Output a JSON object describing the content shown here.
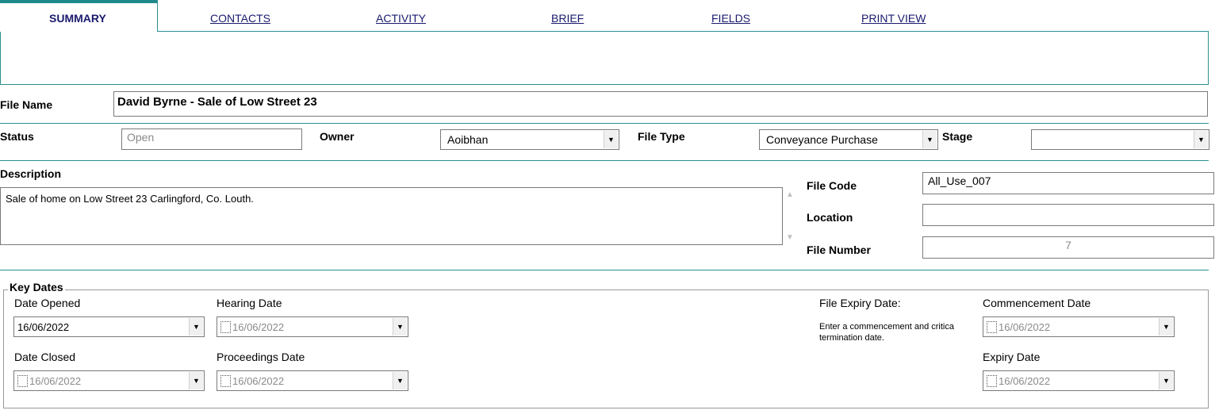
{
  "tabs": {
    "summary": "SUMMARY",
    "contacts": "CONTACTS",
    "activity": "ACTIVITY",
    "brief": "BRIEF",
    "fields": "FIELDS",
    "print_view": "PRINT VIEW"
  },
  "file_name": {
    "label": "File Name",
    "value": "David Byrne - Sale of Low Street 23"
  },
  "status": {
    "label": "Status",
    "value": "Open"
  },
  "owner": {
    "label": "Owner",
    "value": "Aoibhan"
  },
  "file_type": {
    "label": "File Type",
    "value": "Conveyance Purchase"
  },
  "stage": {
    "label": "Stage",
    "value": ""
  },
  "description": {
    "label": "Description",
    "value": "Sale of home on Low Street 23 Carlingford, Co. Louth."
  },
  "file_code": {
    "label": "File Code",
    "value": "All_Use_007"
  },
  "location": {
    "label": "Location",
    "value": ""
  },
  "file_number": {
    "label": "File Number",
    "value": "7"
  },
  "key_dates": {
    "title": "Key Dates",
    "date_opened": {
      "label": "Date Opened",
      "value": "16/06/2022"
    },
    "hearing_date": {
      "label": "Hearing Date",
      "value": "16/06/2022"
    },
    "date_closed": {
      "label": "Date Closed",
      "value": "16/06/2022"
    },
    "proceedings_date": {
      "label": "Proceedings Date",
      "value": "16/06/2022"
    },
    "file_expiry": {
      "label": "File Expiry Date:",
      "hint": "Enter a commencement and critica termination date."
    },
    "commencement_date": {
      "label": "Commencement Date",
      "value": "16/06/2022"
    },
    "expiry_date": {
      "label": "Expiry Date",
      "value": "16/06/2022"
    }
  }
}
